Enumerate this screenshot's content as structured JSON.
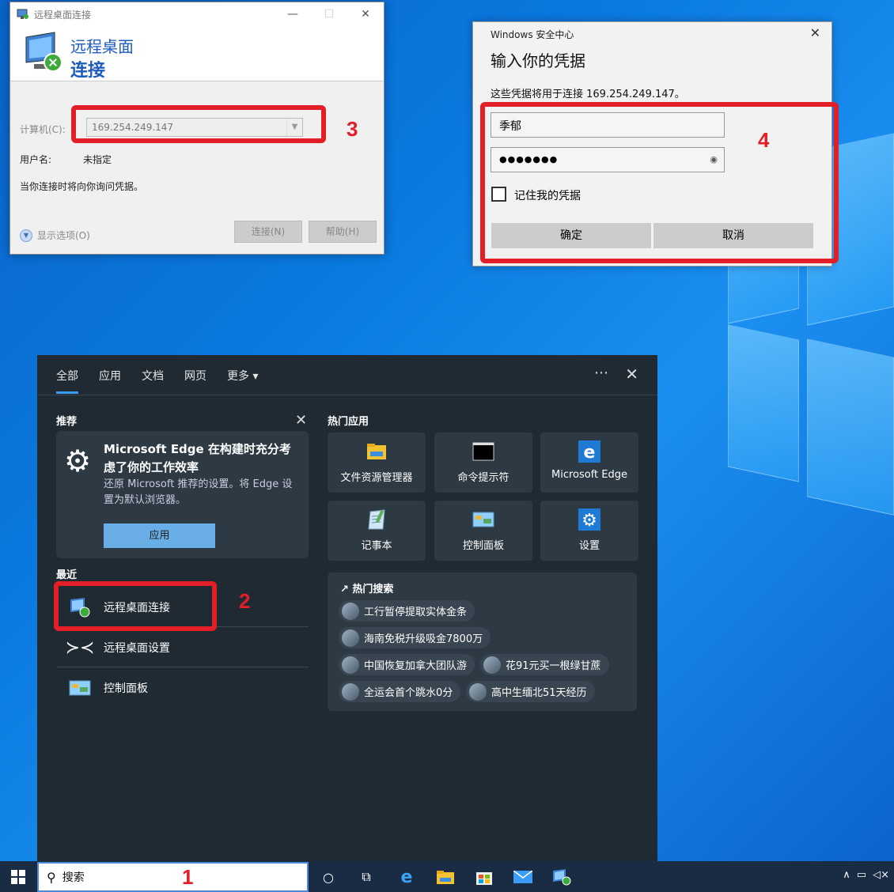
{
  "rdp_window": {
    "title": "远程桌面连接",
    "banner_line1": "远程桌面",
    "banner_line2": "连接",
    "computer_label": "计算机(C):",
    "computer_value": "169.254.249.147",
    "username_label": "用户名:",
    "username_value": "未指定",
    "note": "当你连接时将向你询问凭据。",
    "show_options": "显示选项(O)",
    "connect_button": "连接(N)",
    "help_button": "帮助(H)"
  },
  "security_dialog": {
    "header": "Windows 安全中心",
    "title": "输入你的凭据",
    "description": "这些凭据将用于连接 169.254.249.147。",
    "username": "季郁",
    "password_mask": "●●●●●●●",
    "remember": "记住我的凭据",
    "ok_button": "确定",
    "cancel_button": "取消"
  },
  "markers": [
    "1",
    "2",
    "3",
    "4"
  ],
  "search_panel": {
    "tabs": [
      "全部",
      "应用",
      "文档",
      "网页",
      "更多 ▾"
    ],
    "recommend_header": "推荐",
    "recommend_title": "Microsoft Edge 在构建时充分考虑了你的工作效率",
    "recommend_desc": "还原 Microsoft 推荐的设置。将 Edge 设置为默认浏览器。",
    "recommend_button": "应用",
    "recent_header": "最近",
    "recent_items": [
      "远程桌面连接",
      "远程桌面设置",
      "控制面板"
    ],
    "hot_apps_header": "热门应用",
    "hot_apps": [
      "文件资源管理器",
      "命令提示符",
      "Microsoft Edge",
      "记事本",
      "控制面板",
      "设置"
    ],
    "hot_search_header": "热门搜索",
    "hot_searches": [
      "工行暂停提取实体金条",
      "海南免税升级吸金7800万",
      "中国恢复加拿大团队游",
      "花91元买一根绿甘蔗",
      "全运会首个跳水0分",
      "高中生缅北51天经历"
    ]
  },
  "taskbar": {
    "search_placeholder": "搜索"
  },
  "colors": {
    "accent_red": "#e21f26",
    "panel_bg": "#1f2a33",
    "desktop_blue": "#0a7ae0"
  }
}
